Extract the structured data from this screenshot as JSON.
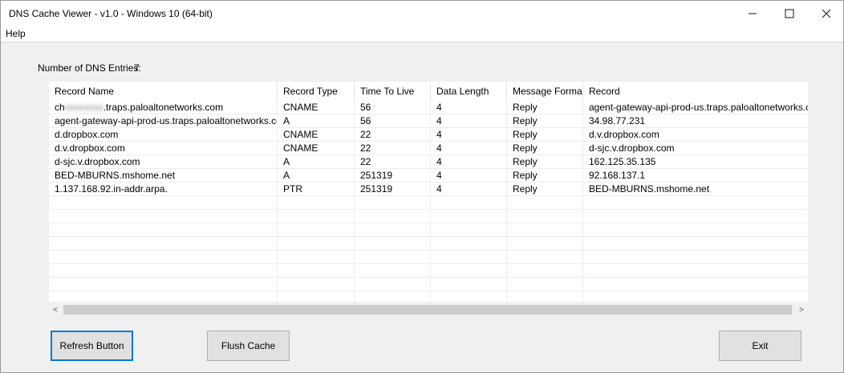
{
  "window": {
    "title": "DNS Cache Viewer - v1.0 - Windows 10  (64-bit)",
    "controls": {
      "minimize": "—",
      "maximize": "☐",
      "close": "✕"
    }
  },
  "menu": {
    "help": "Help"
  },
  "summary": {
    "label": "Number of DNS Entries:",
    "count": "7"
  },
  "table": {
    "columns": [
      "Record Name",
      "Record Type",
      "Time To Live",
      "Data Length",
      "Message Format",
      "Record"
    ],
    "rows": [
      {
        "name_prefix": "ch",
        "name_blurred": "xxxxxxxx",
        "name_suffix": ".traps.paloaltonetworks.com",
        "type": "CNAME",
        "ttl": "56",
        "length": "4",
        "format": "Reply",
        "record": "agent-gateway-api-prod-us.traps.paloaltonetworks.com"
      },
      {
        "name": "agent-gateway-api-prod-us.traps.paloaltonetworks.com",
        "type": "A",
        "ttl": "56",
        "length": "4",
        "format": "Reply",
        "record": "34.98.77.231"
      },
      {
        "name": "d.dropbox.com",
        "type": "CNAME",
        "ttl": "22",
        "length": "4",
        "format": "Reply",
        "record": "d.v.dropbox.com"
      },
      {
        "name": "d.v.dropbox.com",
        "type": "CNAME",
        "ttl": "22",
        "length": "4",
        "format": "Reply",
        "record": "d-sjc.v.dropbox.com"
      },
      {
        "name": "d-sjc.v.dropbox.com",
        "type": "A",
        "ttl": "22",
        "length": "4",
        "format": "Reply",
        "record": "162.125.35.135"
      },
      {
        "name": "BED-MBURNS.mshome.net",
        "type": "A",
        "ttl": "251319",
        "length": "4",
        "format": "Reply",
        "record": "92.168.137.1"
      },
      {
        "name": "1.137.168.92.in-addr.arpa.",
        "type": "PTR",
        "ttl": "251319",
        "length": "4",
        "format": "Reply",
        "record": "BED-MBURNS.mshome.net"
      }
    ]
  },
  "scrollbar": {
    "left_arrow": "<",
    "right_arrow": ">"
  },
  "buttons": {
    "refresh": "Refresh Button",
    "flush": "Flush Cache",
    "exit": "Exit"
  }
}
